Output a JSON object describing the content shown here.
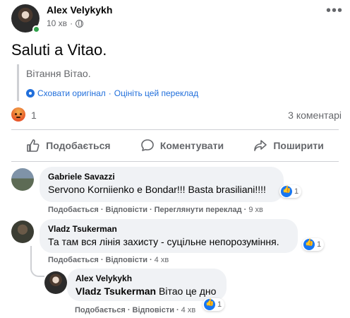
{
  "post": {
    "author": "Alex Velykykh",
    "time": "10 хв",
    "dot": "·",
    "text": "Saluti a Vitao.",
    "translation": "Вітання Вітао.",
    "hide_original": "Сховати оригінал",
    "separator": "·",
    "rate_translation": "Оцініть цей переклад",
    "reaction_count": "1",
    "comments_count": "3 коментарі"
  },
  "actions": {
    "like": "Подобається",
    "comment": "Коментувати",
    "share": "Поширити"
  },
  "comments": [
    {
      "name": "Gabriele Savazzi",
      "text": "Servono Korniienko e Bondar!!! Basta brasiliani!!!!",
      "likes": "1",
      "like_label": "Подобається",
      "reply_label": "Відповісти",
      "translate_label": "Переглянути переклад",
      "time": "9 хв"
    },
    {
      "name": "Vladz Tsukerman",
      "text": "Та там вся лінія захисту - суцільне непорозуміння.",
      "likes": "1",
      "like_label": "Подобається",
      "reply_label": "Відповісти",
      "time": "4 хв"
    },
    {
      "name": "Alex Velykykh",
      "mention": "Vladz Tsukerman",
      "text": "Вітао це дно",
      "likes": "1",
      "like_label": "Подобається",
      "reply_label": "Відповісти",
      "time": "4 хв"
    }
  ],
  "colors": {
    "accent": "#1877f2",
    "link": "#216fdb",
    "muted": "#65676b",
    "bubble": "#f0f2f5",
    "online": "#31a24c"
  },
  "icons": [
    "globe-icon",
    "more-icon",
    "gear-icon",
    "angry-reaction-icon",
    "like-icon",
    "comment-icon",
    "share-icon"
  ]
}
